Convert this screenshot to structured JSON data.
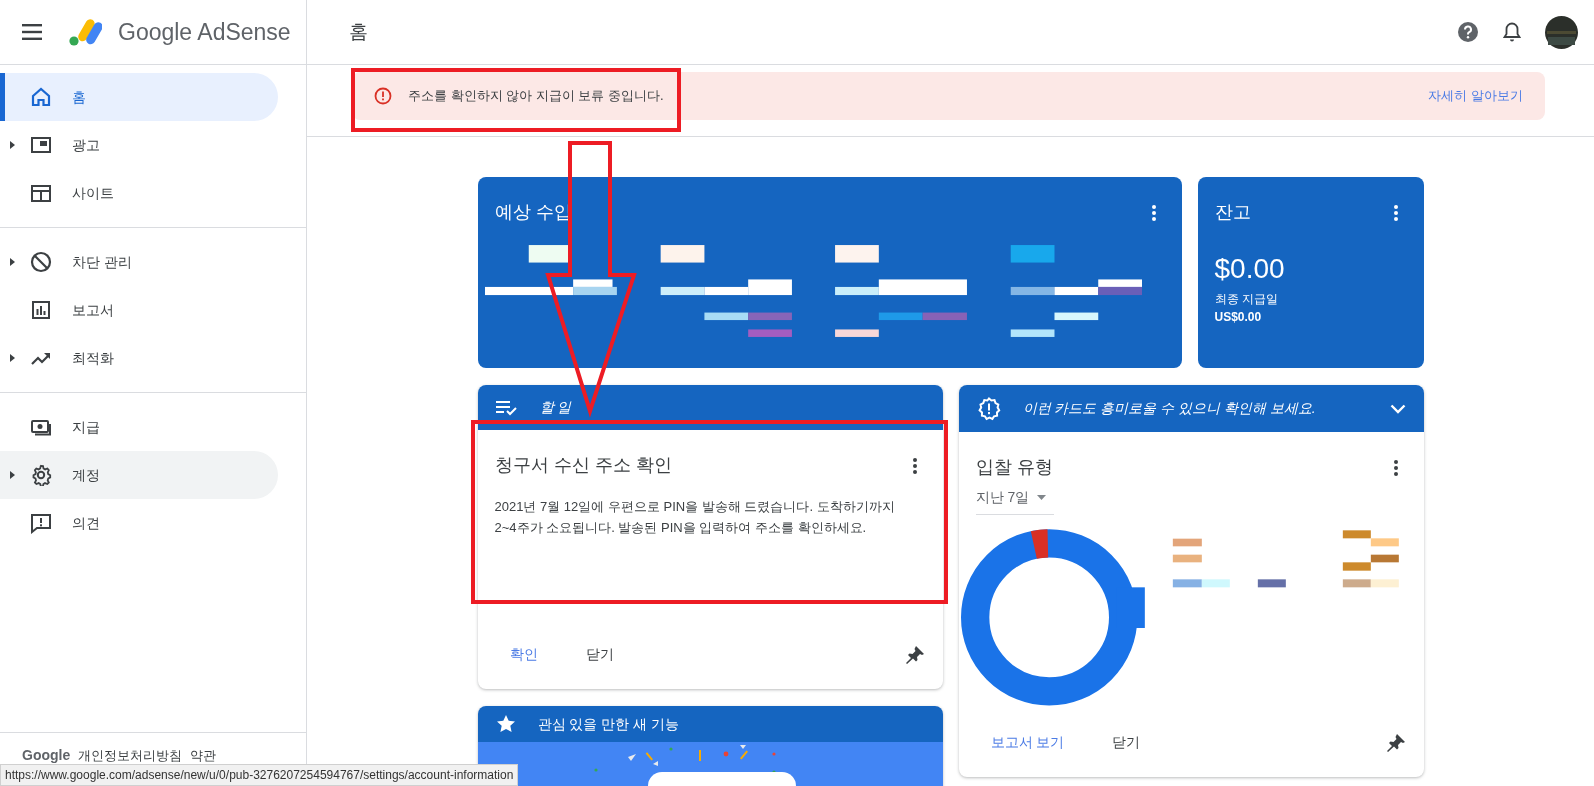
{
  "header": {
    "app_name": "Google AdSense",
    "page_title": "홈"
  },
  "sidebar": {
    "groups": [
      [
        {
          "label": "홈",
          "expandable": false,
          "selected": true,
          "hovered": false
        },
        {
          "label": "광고",
          "expandable": true,
          "selected": false,
          "hovered": false
        },
        {
          "label": "사이트",
          "expandable": false,
          "selected": false,
          "hovered": false
        }
      ],
      [
        {
          "label": "차단 관리",
          "expandable": true,
          "selected": false,
          "hovered": false
        },
        {
          "label": "보고서",
          "expandable": false,
          "selected": false,
          "hovered": false
        },
        {
          "label": "최적화",
          "expandable": true,
          "selected": false,
          "hovered": false
        }
      ],
      [
        {
          "label": "지급",
          "expandable": false,
          "selected": false,
          "hovered": false
        },
        {
          "label": "계정",
          "expandable": true,
          "selected": false,
          "hovered": true
        },
        {
          "label": "의견",
          "expandable": false,
          "selected": false,
          "hovered": false
        }
      ]
    ],
    "footer": {
      "brand": "Google",
      "links": [
        "개인정보처리방침",
        "약관"
      ]
    }
  },
  "alert": {
    "message": "주소를 확인하지 않아 지급이 보류 중입니다.",
    "link": "자세히 알아보기"
  },
  "revenue_card": {
    "title": "예상 수입"
  },
  "balance_card": {
    "title": "잔고",
    "amount": "$0.00",
    "label": "최종 지급일",
    "value": "US$0.00"
  },
  "todo_card": {
    "header": "할 일",
    "title": "청구서 수신 주소 확인",
    "body": "2021년 7월 12일에 우편으로 PIN을 발송해 드렸습니다. 도착하기까지 2~4주가 소요됩니다. 발송된 PIN을 입력하여 주소를 확인하세요.",
    "actions": [
      "확인",
      "닫기"
    ]
  },
  "suggestion_card": {
    "header": "이런 카드도 흥미로울 수 있으니 확인해 보세요.",
    "title": "입찰 유형",
    "range": "지난 7일",
    "actions": [
      "보고서 보기",
      "닫기"
    ]
  },
  "features_card": {
    "header": "관심 있을 만한 새 기능"
  },
  "status_bar": {
    "url": "https://www.google.com/adsense/new/u/0/pub-3276207254594767/settings/account-information"
  }
}
